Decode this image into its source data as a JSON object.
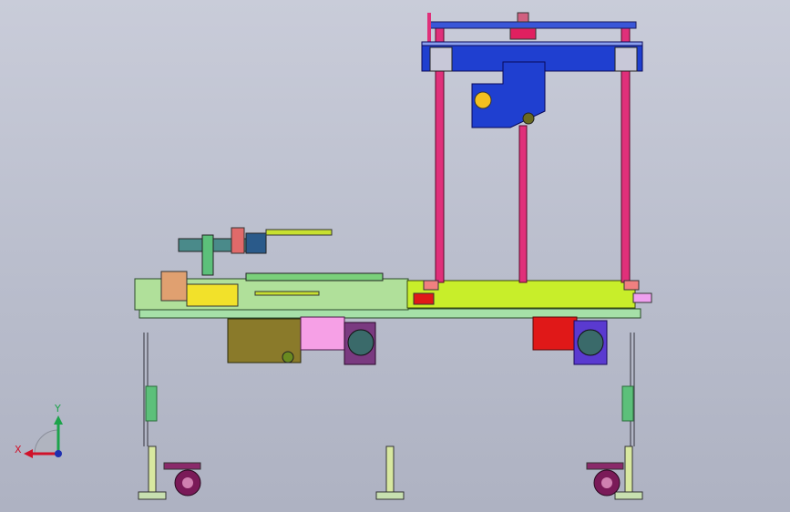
{
  "viewport": {
    "background": "#c0c3d1",
    "view_triad": {
      "x_label": "X",
      "y_label": "Y",
      "x_color": "#d0122a",
      "y_color": "#1ca34a",
      "z_color": "#1f2fb0"
    }
  },
  "colors": {
    "frame_blue": "#1f3fd0",
    "column_pink": "#e0307a",
    "table_lime": "#c8ee2a",
    "plate_green": "#a6e0a8",
    "bracket_yellow": "#f2e12a",
    "motor_olive": "#8a7a2a",
    "motor_pink": "#f6a0e6",
    "motor_purple": "#7a3a80",
    "red_block": "#e01818",
    "caster_purple": "#7a1a58",
    "leg_green": "#5cc07a",
    "orange_block": "#e0a070"
  }
}
